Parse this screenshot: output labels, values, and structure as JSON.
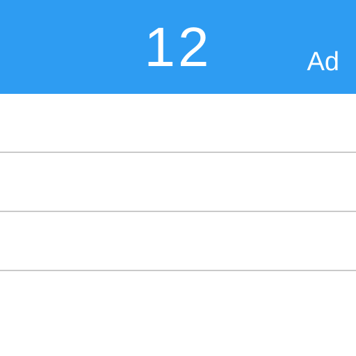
{
  "header": {
    "title": "12",
    "ad_label": "Ad"
  },
  "list": {
    "rows": [
      {},
      {},
      {}
    ]
  },
  "colors": {
    "header_bg": "#2e9cf2",
    "row_border": "#c9c9c9"
  }
}
